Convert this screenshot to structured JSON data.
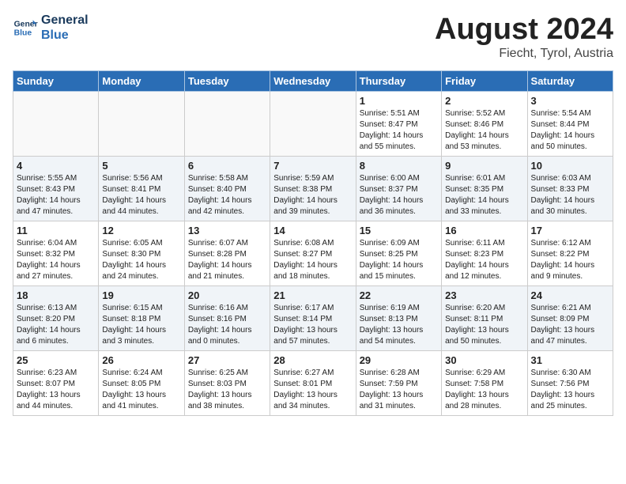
{
  "header": {
    "logo_line1": "General",
    "logo_line2": "Blue",
    "month_year": "August 2024",
    "location": "Fiecht, Tyrol, Austria"
  },
  "days_of_week": [
    "Sunday",
    "Monday",
    "Tuesday",
    "Wednesday",
    "Thursday",
    "Friday",
    "Saturday"
  ],
  "weeks": [
    [
      {
        "num": "",
        "info": ""
      },
      {
        "num": "",
        "info": ""
      },
      {
        "num": "",
        "info": ""
      },
      {
        "num": "",
        "info": ""
      },
      {
        "num": "1",
        "info": "Sunrise: 5:51 AM\nSunset: 8:47 PM\nDaylight: 14 hours\nand 55 minutes."
      },
      {
        "num": "2",
        "info": "Sunrise: 5:52 AM\nSunset: 8:46 PM\nDaylight: 14 hours\nand 53 minutes."
      },
      {
        "num": "3",
        "info": "Sunrise: 5:54 AM\nSunset: 8:44 PM\nDaylight: 14 hours\nand 50 minutes."
      }
    ],
    [
      {
        "num": "4",
        "info": "Sunrise: 5:55 AM\nSunset: 8:43 PM\nDaylight: 14 hours\nand 47 minutes."
      },
      {
        "num": "5",
        "info": "Sunrise: 5:56 AM\nSunset: 8:41 PM\nDaylight: 14 hours\nand 44 minutes."
      },
      {
        "num": "6",
        "info": "Sunrise: 5:58 AM\nSunset: 8:40 PM\nDaylight: 14 hours\nand 42 minutes."
      },
      {
        "num": "7",
        "info": "Sunrise: 5:59 AM\nSunset: 8:38 PM\nDaylight: 14 hours\nand 39 minutes."
      },
      {
        "num": "8",
        "info": "Sunrise: 6:00 AM\nSunset: 8:37 PM\nDaylight: 14 hours\nand 36 minutes."
      },
      {
        "num": "9",
        "info": "Sunrise: 6:01 AM\nSunset: 8:35 PM\nDaylight: 14 hours\nand 33 minutes."
      },
      {
        "num": "10",
        "info": "Sunrise: 6:03 AM\nSunset: 8:33 PM\nDaylight: 14 hours\nand 30 minutes."
      }
    ],
    [
      {
        "num": "11",
        "info": "Sunrise: 6:04 AM\nSunset: 8:32 PM\nDaylight: 14 hours\nand 27 minutes."
      },
      {
        "num": "12",
        "info": "Sunrise: 6:05 AM\nSunset: 8:30 PM\nDaylight: 14 hours\nand 24 minutes."
      },
      {
        "num": "13",
        "info": "Sunrise: 6:07 AM\nSunset: 8:28 PM\nDaylight: 14 hours\nand 21 minutes."
      },
      {
        "num": "14",
        "info": "Sunrise: 6:08 AM\nSunset: 8:27 PM\nDaylight: 14 hours\nand 18 minutes."
      },
      {
        "num": "15",
        "info": "Sunrise: 6:09 AM\nSunset: 8:25 PM\nDaylight: 14 hours\nand 15 minutes."
      },
      {
        "num": "16",
        "info": "Sunrise: 6:11 AM\nSunset: 8:23 PM\nDaylight: 14 hours\nand 12 minutes."
      },
      {
        "num": "17",
        "info": "Sunrise: 6:12 AM\nSunset: 8:22 PM\nDaylight: 14 hours\nand 9 minutes."
      }
    ],
    [
      {
        "num": "18",
        "info": "Sunrise: 6:13 AM\nSunset: 8:20 PM\nDaylight: 14 hours\nand 6 minutes."
      },
      {
        "num": "19",
        "info": "Sunrise: 6:15 AM\nSunset: 8:18 PM\nDaylight: 14 hours\nand 3 minutes."
      },
      {
        "num": "20",
        "info": "Sunrise: 6:16 AM\nSunset: 8:16 PM\nDaylight: 14 hours\nand 0 minutes."
      },
      {
        "num": "21",
        "info": "Sunrise: 6:17 AM\nSunset: 8:14 PM\nDaylight: 13 hours\nand 57 minutes."
      },
      {
        "num": "22",
        "info": "Sunrise: 6:19 AM\nSunset: 8:13 PM\nDaylight: 13 hours\nand 54 minutes."
      },
      {
        "num": "23",
        "info": "Sunrise: 6:20 AM\nSunset: 8:11 PM\nDaylight: 13 hours\nand 50 minutes."
      },
      {
        "num": "24",
        "info": "Sunrise: 6:21 AM\nSunset: 8:09 PM\nDaylight: 13 hours\nand 47 minutes."
      }
    ],
    [
      {
        "num": "25",
        "info": "Sunrise: 6:23 AM\nSunset: 8:07 PM\nDaylight: 13 hours\nand 44 minutes."
      },
      {
        "num": "26",
        "info": "Sunrise: 6:24 AM\nSunset: 8:05 PM\nDaylight: 13 hours\nand 41 minutes."
      },
      {
        "num": "27",
        "info": "Sunrise: 6:25 AM\nSunset: 8:03 PM\nDaylight: 13 hours\nand 38 minutes."
      },
      {
        "num": "28",
        "info": "Sunrise: 6:27 AM\nSunset: 8:01 PM\nDaylight: 13 hours\nand 34 minutes."
      },
      {
        "num": "29",
        "info": "Sunrise: 6:28 AM\nSunset: 7:59 PM\nDaylight: 13 hours\nand 31 minutes."
      },
      {
        "num": "30",
        "info": "Sunrise: 6:29 AM\nSunset: 7:58 PM\nDaylight: 13 hours\nand 28 minutes."
      },
      {
        "num": "31",
        "info": "Sunrise: 6:30 AM\nSunset: 7:56 PM\nDaylight: 13 hours\nand 25 minutes."
      }
    ]
  ]
}
